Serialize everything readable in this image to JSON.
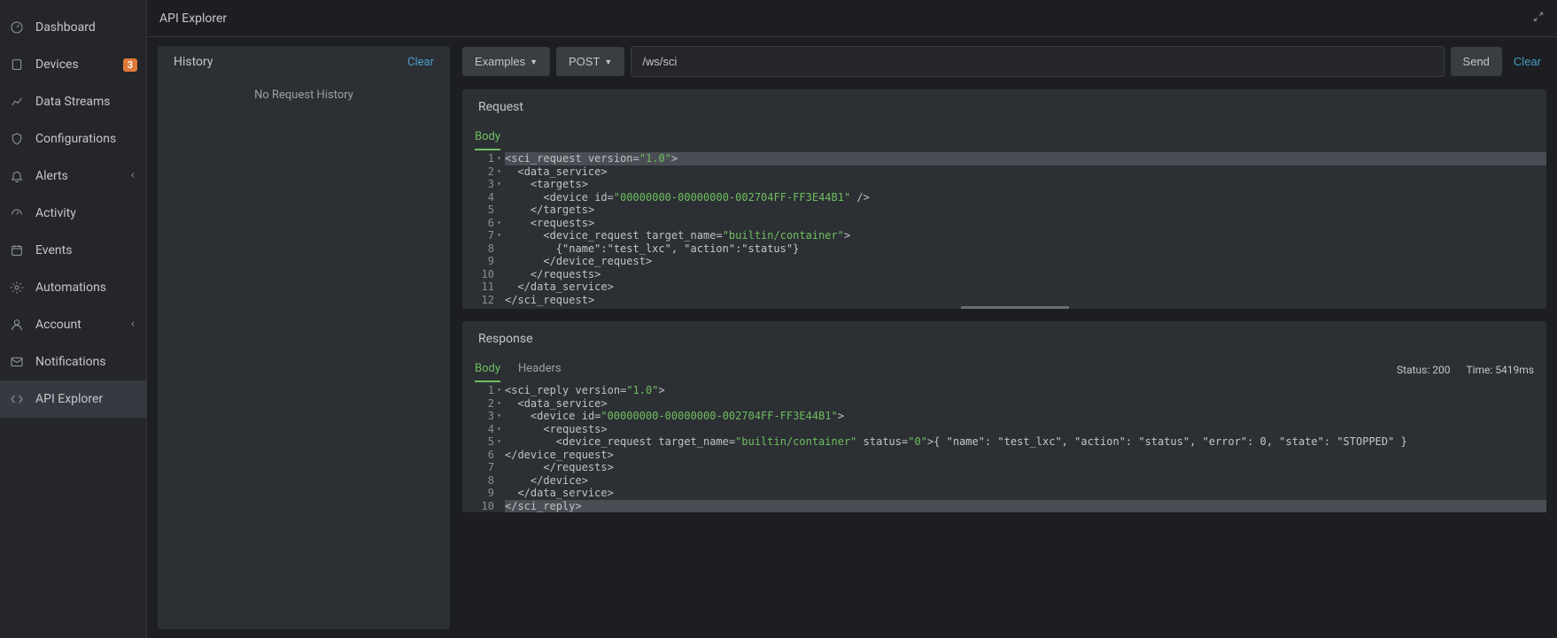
{
  "page_title": "API Explorer",
  "sidebar": {
    "items": [
      {
        "label": "Dashboard",
        "icon": "gauge"
      },
      {
        "label": "Devices",
        "icon": "device",
        "badge": "3"
      },
      {
        "label": "Data Streams",
        "icon": "chart"
      },
      {
        "label": "Configurations",
        "icon": "shield"
      },
      {
        "label": "Alerts",
        "icon": "bell",
        "expandable": true
      },
      {
        "label": "Activity",
        "icon": "activity"
      },
      {
        "label": "Events",
        "icon": "calendar"
      },
      {
        "label": "Automations",
        "icon": "gear"
      },
      {
        "label": "Account",
        "icon": "user",
        "expandable": true
      },
      {
        "label": "Notifications",
        "icon": "mail"
      },
      {
        "label": "API Explorer",
        "icon": "code",
        "active": true
      }
    ]
  },
  "history": {
    "title": "History",
    "clear": "Clear",
    "empty": "No Request History"
  },
  "toolbar": {
    "examples": "Examples",
    "method": "POST",
    "url": "/ws/sci",
    "send": "Send",
    "clear": "Clear"
  },
  "request": {
    "title": "Request",
    "tab_body": "Body",
    "lines": [
      {
        "html": "<span class='punc'>&lt;</span><span class='tag'>sci_request</span> <span class='attr'>version</span><span class='punc'>=</span><span class='str'>\"1.0\"</span><span class='punc'>&gt;</span>",
        "fold": true,
        "sel": true
      },
      {
        "html": "  <span class='punc'>&lt;</span><span class='tag'>data_service</span><span class='punc'>&gt;</span>",
        "fold": true
      },
      {
        "html": "    <span class='punc'>&lt;</span><span class='tag'>targets</span><span class='punc'>&gt;</span>",
        "fold": true
      },
      {
        "html": "      <span class='punc'>&lt;</span><span class='tag'>device</span> <span class='attr'>id</span><span class='punc'>=</span><span class='str'>\"00000000-00000000-002704FF-FF3E44B1\"</span> <span class='punc'>/&gt;</span>"
      },
      {
        "html": "    <span class='punc'>&lt;/</span><span class='tag'>targets</span><span class='punc'>&gt;</span>"
      },
      {
        "html": "    <span class='punc'>&lt;</span><span class='tag'>requests</span><span class='punc'>&gt;</span>",
        "fold": true
      },
      {
        "html": "      <span class='punc'>&lt;</span><span class='tag'>device_request</span> <span class='attr'>target_name</span><span class='punc'>=</span><span class='str'>\"builtin/container\"</span><span class='punc'>&gt;</span>",
        "fold": true
      },
      {
        "html": "        {\"name\":\"test_lxc\", \"action\":\"status\"}"
      },
      {
        "html": "      <span class='punc'>&lt;/</span><span class='tag'>device_request</span><span class='punc'>&gt;</span>"
      },
      {
        "html": "    <span class='punc'>&lt;/</span><span class='tag'>requests</span><span class='punc'>&gt;</span>"
      },
      {
        "html": "  <span class='punc'>&lt;/</span><span class='tag'>data_service</span><span class='punc'>&gt;</span>"
      },
      {
        "html": "<span class='punc'>&lt;/</span><span class='tag'>sci_request</span><span class='punc'>&gt;</span>"
      }
    ]
  },
  "response": {
    "title": "Response",
    "tab_body": "Body",
    "tab_headers": "Headers",
    "status_label": "Status: 200",
    "time_label": "Time: 5419ms",
    "lines": [
      {
        "html": "<span class='punc'>&lt;</span><span class='tag'>sci_reply</span> <span class='attr'>version</span><span class='punc'>=</span><span class='str'>\"1.0\"</span><span class='punc'>&gt;</span>",
        "fold": true
      },
      {
        "html": "  <span class='punc'>&lt;</span><span class='tag'>data_service</span><span class='punc'>&gt;</span>",
        "fold": true
      },
      {
        "html": "    <span class='punc'>&lt;</span><span class='tag'>device</span> <span class='attr'>id</span><span class='punc'>=</span><span class='str'>\"00000000-00000000-002704FF-FF3E44B1\"</span><span class='punc'>&gt;</span>",
        "fold": true
      },
      {
        "html": "      <span class='punc'>&lt;</span><span class='tag'>requests</span><span class='punc'>&gt;</span>",
        "fold": true
      },
      {
        "html": "        <span class='punc'>&lt;</span><span class='tag'>device_request</span> <span class='attr'>target_name</span><span class='punc'>=</span><span class='str'>\"builtin/container\"</span> <span class='attr'>status</span><span class='punc'>=</span><span class='str'>\"0\"</span><span class='punc'>&gt;</span>{ \"name\": \"test_lxc\", \"action\": \"status\", \"error\": 0, \"state\": \"STOPPED\" }",
        "fold": true
      },
      {
        "html": "<span class='punc'>&lt;/</span><span class='tag'>device_request</span><span class='punc'>&gt;</span>"
      },
      {
        "html": "      <span class='punc'>&lt;/</span><span class='tag'>requests</span><span class='punc'>&gt;</span>"
      },
      {
        "html": "    <span class='punc'>&lt;/</span><span class='tag'>device</span><span class='punc'>&gt;</span>"
      },
      {
        "html": "  <span class='punc'>&lt;/</span><span class='tag'>data_service</span><span class='punc'>&gt;</span>"
      },
      {
        "html": "<span class='punc'>&lt;/</span><span class='tag'>sci_reply</span><span class='punc'>&gt;</span>",
        "sel": true
      }
    ]
  }
}
